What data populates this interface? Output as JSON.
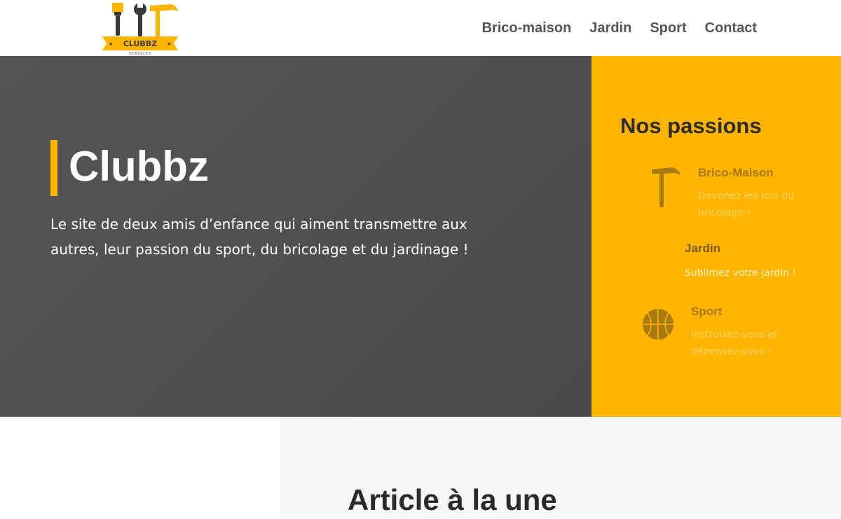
{
  "colors": {
    "accent": "#ffb400",
    "hero_bg": "#4f4f4f",
    "nav_text": "#555555",
    "icon_dark": "#a87a10",
    "desc_faded": "#ffd567",
    "desc_light": "#fff4cc"
  },
  "logo": {
    "icon": "tools-logo-icon",
    "brand": "CLUBBZ",
    "tagline": "SERVICES"
  },
  "nav": {
    "items": [
      {
        "label": "Brico-maison"
      },
      {
        "label": "Jardin"
      },
      {
        "label": "Sport"
      },
      {
        "label": "Contact"
      }
    ]
  },
  "hero": {
    "title": "Clubbz",
    "text": "Le site de deux amis d’enfance qui aiment transmettre aux autres, leur passion du sport, du bricolage et du jardinage !"
  },
  "passions": {
    "title": "Nos passions",
    "items": [
      {
        "title": "Brico-Maison",
        "desc": "Devenez les rois du bricolage !",
        "icon": "hammer-icon"
      },
      {
        "title": "Jardin",
        "desc": "Sublimez votre jardin !",
        "icon": ""
      },
      {
        "title": "Sport",
        "desc": "Instruisez-vous et dépensez-vous !",
        "icon": "basketball-icon"
      }
    ]
  },
  "featured": {
    "title": "Article à la une"
  }
}
